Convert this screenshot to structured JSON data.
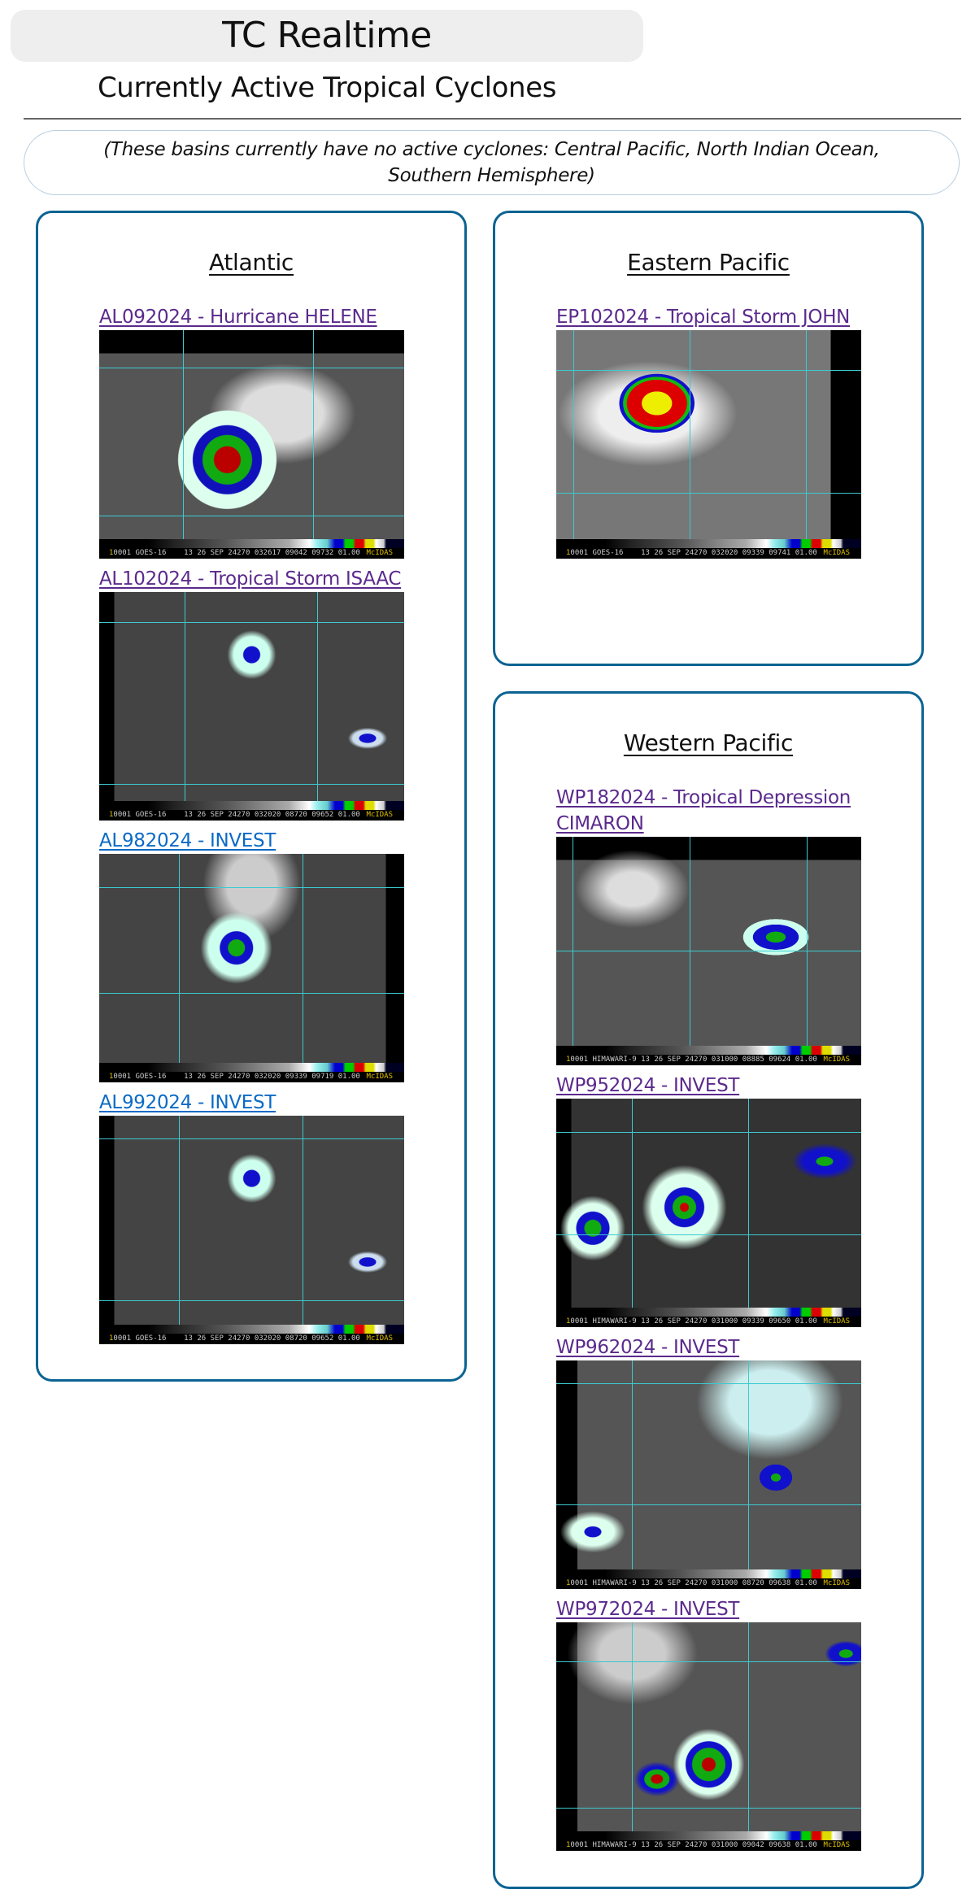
{
  "header": {
    "title": "TC Realtime",
    "subtitle": "Currently Active Tropical Cyclones"
  },
  "notice": {
    "text": "(These basins currently have no active cyclones: Central Pacific, North Indian Ocean, Southern Hemisphere)"
  },
  "colors": {
    "panel_border": "#0b6392",
    "link_visited": "#5b2a8d",
    "link_unvisited": "#0b6ac6",
    "header_bg": "#eeeeee",
    "notice_border": "#b9cfe0"
  },
  "basins": {
    "atlantic": {
      "title": "Atlantic",
      "storms": [
        {
          "link": "AL092024 - Hurricane HELENE",
          "visited": true,
          "image_alt": "AL092024 IR satellite image",
          "caption": "0001 GOES-16    13 26 SEP 24270 032617 09042 09732 01.00",
          "brand": "McIDAS"
        },
        {
          "link": "AL102024 - Tropical Storm ISAAC",
          "visited": true,
          "image_alt": "AL102024 IR satellite image",
          "caption": "0001 GOES-16    13 26 SEP 24270 032020 08720 09652 01.00",
          "brand": "McIDAS"
        },
        {
          "link": "AL982024 - INVEST",
          "visited": false,
          "image_alt": "AL982024 IR satellite image",
          "caption": "0001 GOES-16    13 26 SEP 24270 032020 09339 09719 01.00",
          "brand": "McIDAS"
        },
        {
          "link": "AL992024 - INVEST",
          "visited": false,
          "image_alt": "AL992024 IR satellite image",
          "caption": "0001 GOES-16    13 26 SEP 24270 032020 08720 09652 01.00",
          "brand": "McIDAS"
        }
      ]
    },
    "eastern_pacific": {
      "title": "Eastern Pacific",
      "storms": [
        {
          "link": "EP102024 - Tropical Storm JOHN",
          "visited": true,
          "image_alt": "EP102024 IR satellite image",
          "caption": "0001 GOES-16    13 26 SEP 24270 032020 09339 09741 01.00",
          "brand": "McIDAS"
        }
      ]
    },
    "western_pacific": {
      "title": "Western Pacific",
      "storms": [
        {
          "link": "WP182024 - Tropical Depression CIMARON",
          "visited": true,
          "image_alt": "WP182024 IR satellite image",
          "caption": "0001 HIMAWARI-9 13 26 SEP 24270 031000 08885 09624 01.00",
          "brand": "McIDAS"
        },
        {
          "link": "WP952024 - INVEST",
          "visited": true,
          "image_alt": "WP952024 IR satellite image",
          "caption": "0001 HIMAWARI-9 13 26 SEP 24270 031000 09339 09650 01.00",
          "brand": "McIDAS"
        },
        {
          "link": "WP962024 - INVEST",
          "visited": true,
          "image_alt": "WP962024 IR satellite image",
          "caption": "0001 HIMAWARI-9 13 26 SEP 24270 031000 08720 09638 01.00",
          "brand": "McIDAS"
        },
        {
          "link": "WP972024 - INVEST",
          "visited": true,
          "image_alt": "WP972024 IR satellite image",
          "caption": "0001 HIMAWARI-9 13 26 SEP 24270 031000 09042 09638 01.00",
          "brand": "McIDAS"
        }
      ]
    }
  }
}
